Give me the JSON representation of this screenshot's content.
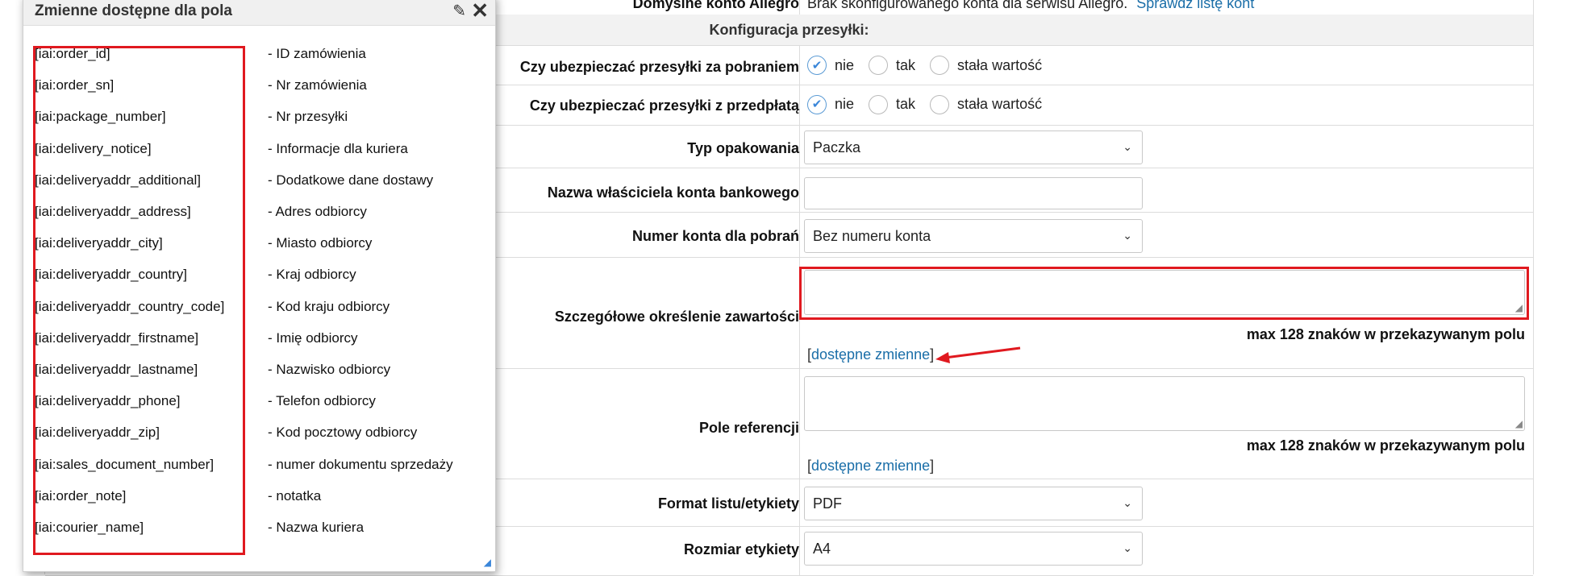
{
  "popup": {
    "title": "Zmienne dostępne dla pola",
    "variables": [
      {
        "code": "[iai:order_id]",
        "desc": "- ID zamówienia"
      },
      {
        "code": "[iai:order_sn]",
        "desc": "- Nr zamówienia"
      },
      {
        "code": "[iai:package_number]",
        "desc": "- Nr przesyłki"
      },
      {
        "code": "[iai:delivery_notice]",
        "desc": "- Informacje dla kuriera"
      },
      {
        "code": "[iai:deliveryaddr_additional]",
        "desc": "- Dodatkowe dane dostawy"
      },
      {
        "code": "[iai:deliveryaddr_address]",
        "desc": "- Adres odbiorcy"
      },
      {
        "code": "[iai:deliveryaddr_city]",
        "desc": "- Miasto odbiorcy"
      },
      {
        "code": "[iai:deliveryaddr_country]",
        "desc": "- Kraj odbiorcy"
      },
      {
        "code": "[iai:deliveryaddr_country_code]",
        "desc": "- Kod kraju odbiorcy"
      },
      {
        "code": "[iai:deliveryaddr_firstname]",
        "desc": "- Imię odbiorcy"
      },
      {
        "code": "[iai:deliveryaddr_lastname]",
        "desc": "- Nazwisko odbiorcy"
      },
      {
        "code": "[iai:deliveryaddr_phone]",
        "desc": "- Telefon odbiorcy"
      },
      {
        "code": "[iai:deliveryaddr_zip]",
        "desc": "- Kod pocztowy odbiorcy"
      },
      {
        "code": "[iai:sales_document_number]",
        "desc": "- numer dokumentu sprzedaży"
      },
      {
        "code": "[iai:order_note]",
        "desc": "- notatka"
      },
      {
        "code": "[iai:courier_name]",
        "desc": "- Nazwa kuriera"
      }
    ]
  },
  "form": {
    "top_row": {
      "label": "Domyślne konto Allegro",
      "text": "Brak skonfigurowanego konta dla serwisu Allegro.",
      "link": "Sprawdź listę kont"
    },
    "section_title": "Konfiguracja przesyłki:",
    "insure_cod": {
      "label": "Czy ubezpieczać przesyłki za pobraniem",
      "options": [
        "nie",
        "tak",
        "stała wartość"
      ],
      "selected": "nie"
    },
    "insure_prepaid": {
      "label": "Czy ubezpieczać przesyłki z przedpłatą",
      "options": [
        "nie",
        "tak",
        "stała wartość"
      ],
      "selected": "nie"
    },
    "package_type": {
      "label": "Typ opakowania",
      "value": "Paczka"
    },
    "account_owner": {
      "label": "Nazwa właściciela konta bankowego",
      "value": ""
    },
    "cod_account": {
      "label": "Numer konta dla pobrań",
      "value": "Bez numeru konta"
    },
    "contents": {
      "label": "Szczegółowe określenie zawartości",
      "value": "",
      "hint": "max 128 znaków w przekazywanym polu",
      "link": "dostępne zmienne"
    },
    "reference": {
      "label": "Pole referencji",
      "value": "",
      "hint": "max 128 znaków w przekazywanym polu",
      "link": "dostępne zmienne"
    },
    "label_format": {
      "label": "Format listu/etykiety",
      "value": "PDF"
    },
    "label_size": {
      "label": "Rozmiar etykiety",
      "value": "A4"
    }
  },
  "colors": {
    "highlight": "#e0191f",
    "link": "#1a6ea8",
    "check": "#3a86d9"
  }
}
